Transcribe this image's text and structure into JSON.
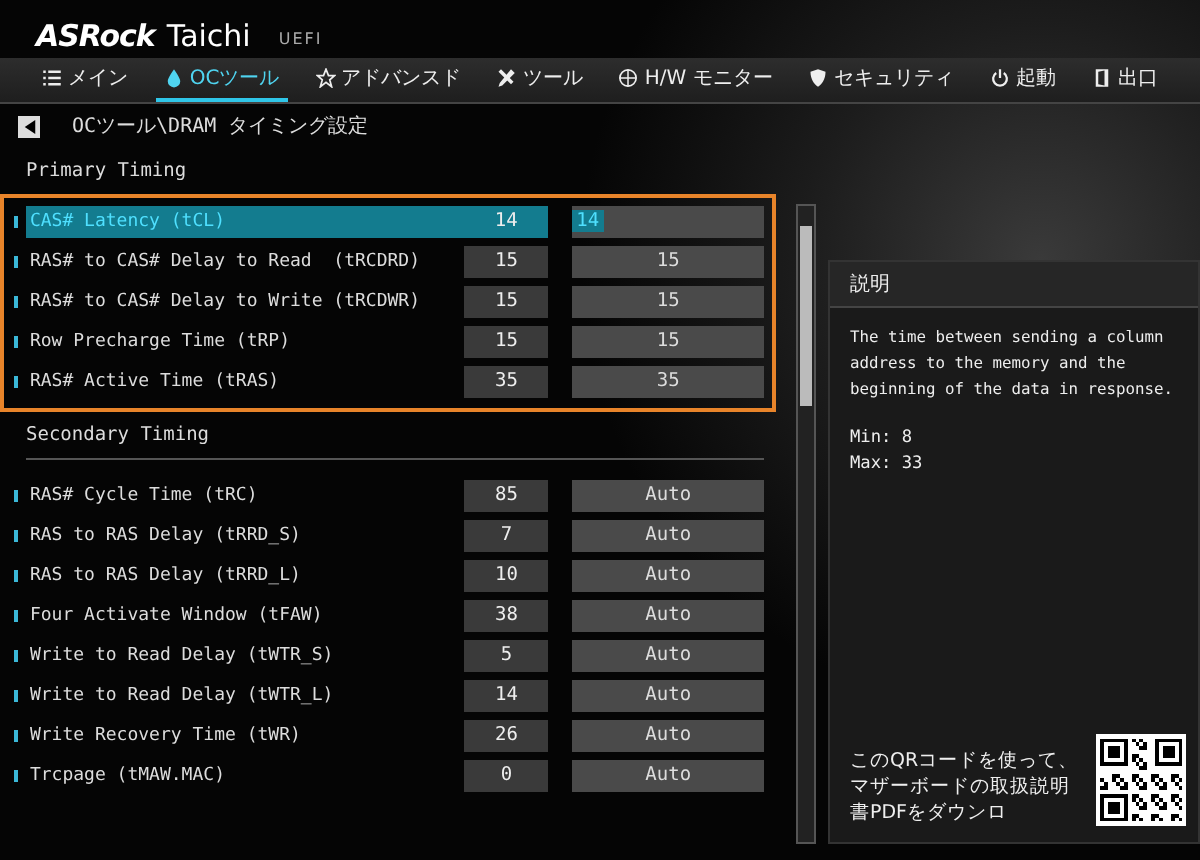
{
  "header": {
    "brand": "ASRock",
    "model": "Taichi",
    "firmware": "UEFI"
  },
  "tabs": [
    {
      "label": "メイン",
      "selected": false
    },
    {
      "label": "OCツール",
      "selected": true
    },
    {
      "label": "アドバンスド",
      "selected": false
    },
    {
      "label": "ツール",
      "selected": false
    },
    {
      "label": "H/W モニター",
      "selected": false
    },
    {
      "label": "セキュリティ",
      "selected": false
    },
    {
      "label": "起動",
      "selected": false
    },
    {
      "label": "出口",
      "selected": false
    }
  ],
  "breadcrumb": "OCツール\\DRAM タイミング設定",
  "sections": [
    {
      "title": "Primary Timing",
      "highlighted": true,
      "rows": [
        {
          "label": "CAS# Latency (tCL)",
          "current": "14",
          "setting": "14",
          "selected": true
        },
        {
          "label": "RAS# to CAS# Delay to Read  (tRCDRD)",
          "current": "15",
          "setting": "15",
          "selected": false
        },
        {
          "label": "RAS# to CAS# Delay to Write (tRCDWR)",
          "current": "15",
          "setting": "15",
          "selected": false
        },
        {
          "label": "Row Precharge Time (tRP)",
          "current": "15",
          "setting": "15",
          "selected": false
        },
        {
          "label": "RAS# Active Time (tRAS)",
          "current": "35",
          "setting": "35",
          "selected": false
        }
      ]
    },
    {
      "title": "Secondary Timing",
      "highlighted": false,
      "rows": [
        {
          "label": "RAS# Cycle Time (tRC)",
          "current": "85",
          "setting": "Auto",
          "selected": false
        },
        {
          "label": "RAS to RAS Delay (tRRD_S)",
          "current": "7",
          "setting": "Auto",
          "selected": false
        },
        {
          "label": "RAS to RAS Delay (tRRD_L)",
          "current": "10",
          "setting": "Auto",
          "selected": false
        },
        {
          "label": "Four Activate Window (tFAW)",
          "current": "38",
          "setting": "Auto",
          "selected": false
        },
        {
          "label": "Write to Read Delay (tWTR_S)",
          "current": "5",
          "setting": "Auto",
          "selected": false
        },
        {
          "label": "Write to Read Delay (tWTR_L)",
          "current": "14",
          "setting": "Auto",
          "selected": false
        },
        {
          "label": "Write Recovery Time (tWR)",
          "current": "26",
          "setting": "Auto",
          "selected": false
        },
        {
          "label": "Trcpage (tMAW.MAC)",
          "current": "0",
          "setting": "Auto",
          "selected": false
        }
      ]
    }
  ],
  "help": {
    "title": "説明",
    "text": "The time between sending a column address to the memory and the beginning of the data in response.",
    "min": "Min: 8",
    "max": "Max: 33",
    "qr_text": "このQRコードを使って、マザーボードの取扱説明書PDFをダウンロ"
  }
}
